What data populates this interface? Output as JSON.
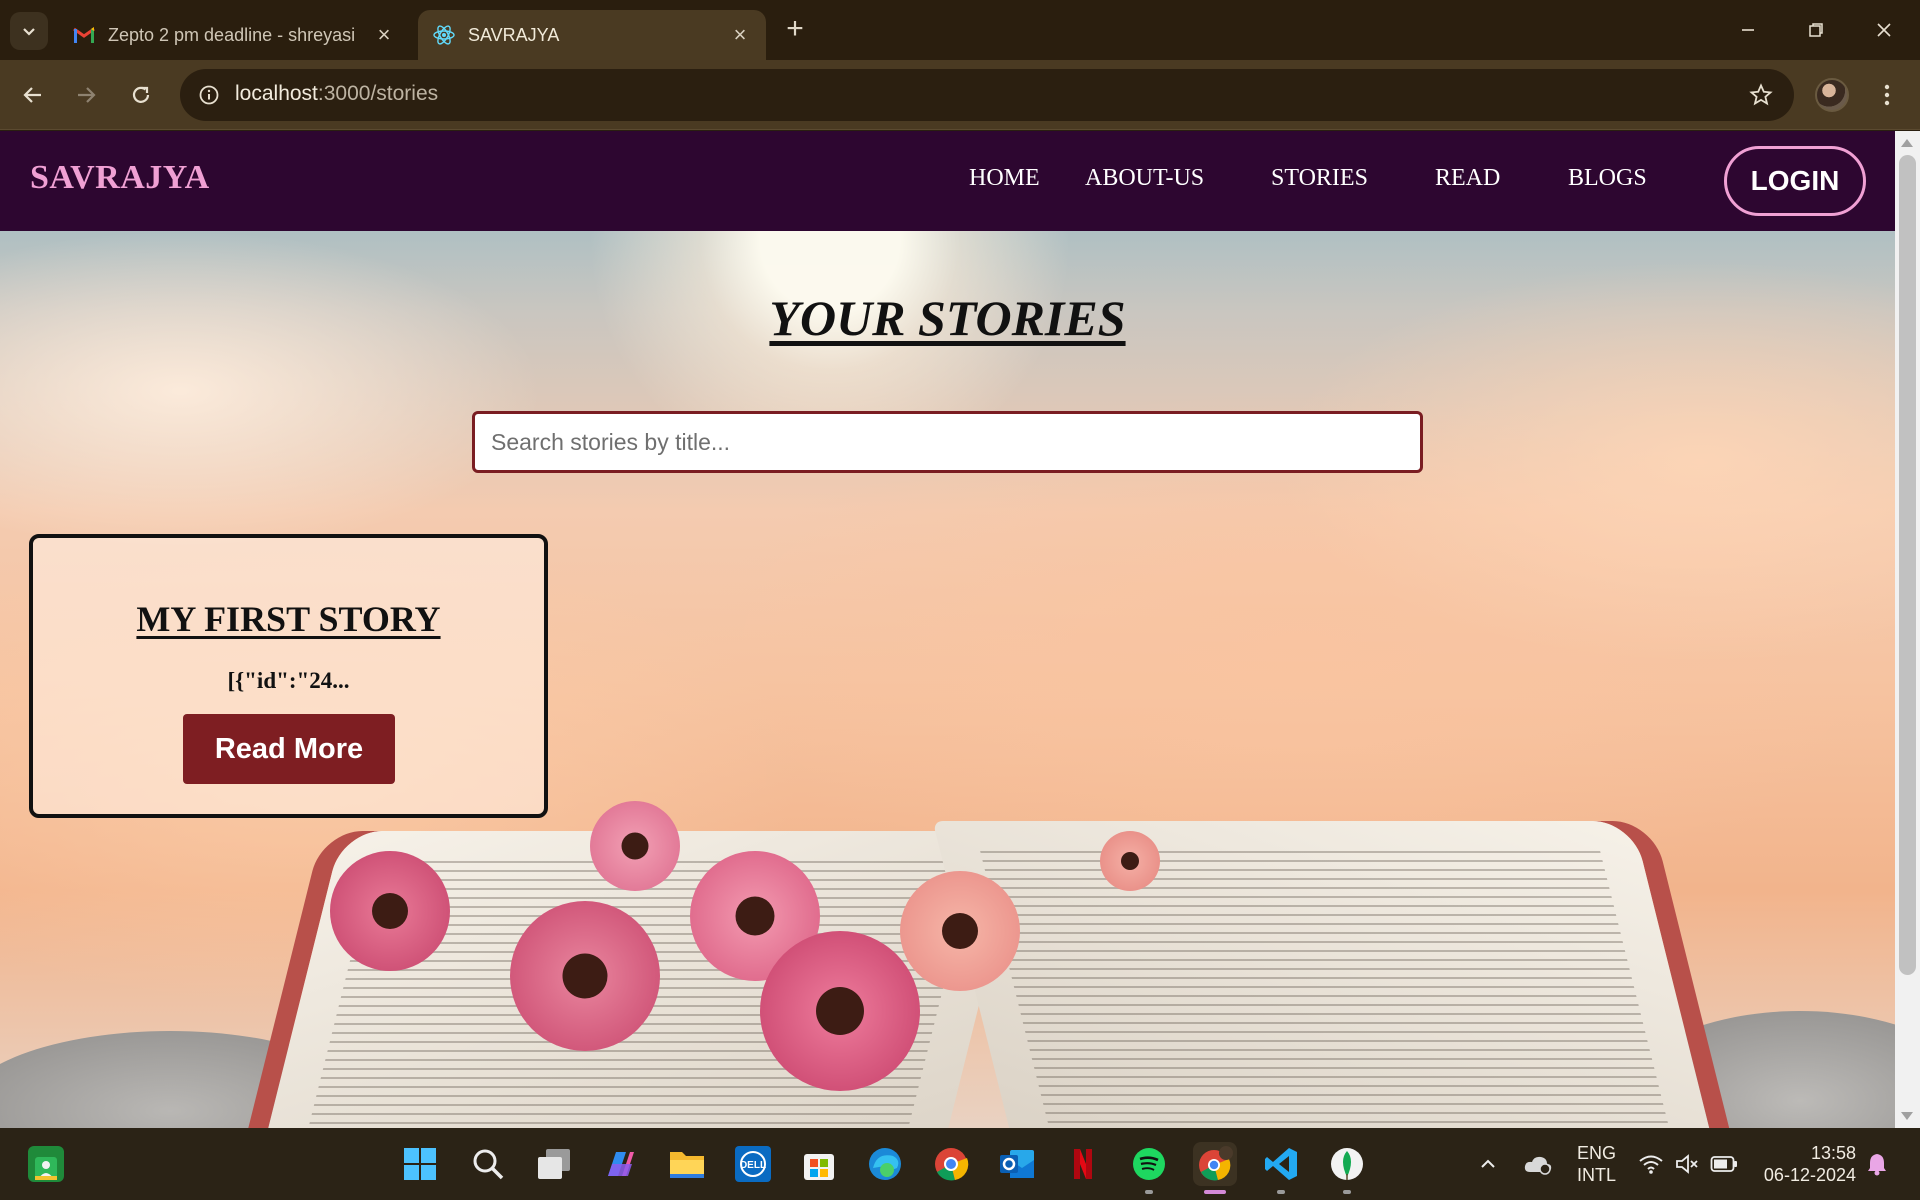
{
  "browser": {
    "tabs": [
      {
        "title": "Zepto 2 pm deadline - shreyasi",
        "icon": "gmail-icon",
        "active": false
      },
      {
        "title": "SAVRAJYA",
        "icon": "react-icon",
        "active": true
      }
    ],
    "url_host": "localhost",
    "url_path": ":3000/stories",
    "accent": "#4a3a22"
  },
  "site": {
    "brand": "SAVRAJYA",
    "nav": [
      "HOME",
      "ABOUT-US",
      "STORIES",
      "READ",
      "BLOGS"
    ],
    "login_label": "LOGIN",
    "nav_bg": "#2d0630",
    "brand_color": "#f0a0d4"
  },
  "stories_page": {
    "heading": "YOUR STORIES",
    "search_placeholder": "Search stories by title...",
    "search_value": "",
    "stories": [
      {
        "title": "MY FIRST STORY",
        "excerpt": "[{\"id\":\"24...",
        "button_label": "Read More"
      }
    ],
    "button_color": "#7e1e22"
  },
  "taskbar": {
    "apps": [
      "start-icon",
      "search-icon",
      "task-view-icon",
      "copilot-icon",
      "file-explorer-icon",
      "dell-icon",
      "microsoft-store-icon",
      "edge-icon",
      "chrome-icon",
      "outlook-icon",
      "netflix-icon",
      "spotify-icon",
      "chrome-profile-icon",
      "vscode-icon",
      "mongodb-compass-icon"
    ],
    "language_line1": "ENG",
    "language_line2": "INTL",
    "time": "13:58",
    "date": "06-12-2024"
  }
}
